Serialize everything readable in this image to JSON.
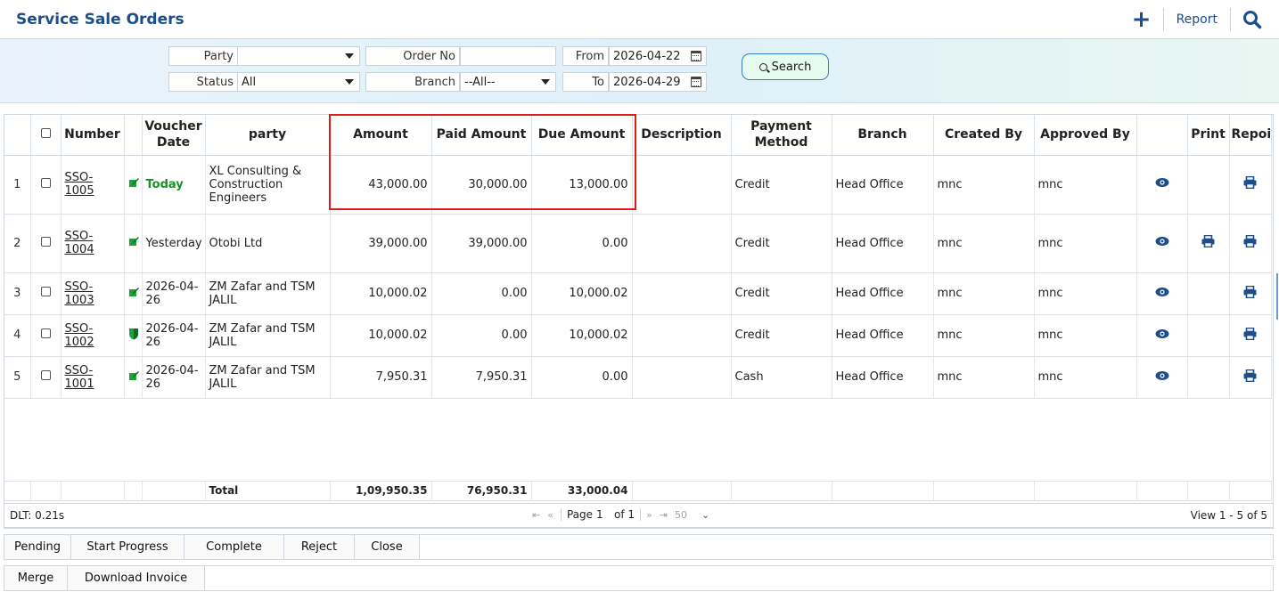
{
  "header": {
    "title": "Service Sale Orders",
    "report_label": "Report"
  },
  "filters": {
    "party_label": "Party",
    "party_value": "",
    "order_no_label": "Order No",
    "order_no_value": "",
    "from_label": "From",
    "from_value": "2026-04-22",
    "status_label": "Status",
    "status_value": "All",
    "branch_label": "Branch",
    "branch_value": "--All--",
    "to_label": "To",
    "to_value": "2026-04-29",
    "search_label": "Search"
  },
  "columns": {
    "number": "Number",
    "voucher_date": "Voucher Date",
    "party": "party",
    "amount": "Amount",
    "paid_amount": "Paid Amount",
    "due_amount": "Due Amount",
    "description": "Description",
    "payment_method": "Payment Method",
    "branch": "Branch",
    "created_by": "Created By",
    "approved_by": "Approved By",
    "print": "Print",
    "report": "Repoi"
  },
  "rows": [
    {
      "n": "1",
      "number": "SSO-1005",
      "date": "Today",
      "party": "XL Consulting & Construction Engineers",
      "amount": "43,000.00",
      "paid": "30,000.00",
      "due": "13,000.00",
      "description": "",
      "payment": "Credit",
      "branch": "Head Office",
      "created": "mnc",
      "approved": "mnc"
    },
    {
      "n": "2",
      "number": "SSO-1004",
      "date": "Yesterday",
      "party": "Otobi Ltd",
      "amount": "39,000.00",
      "paid": "39,000.00",
      "due": "0.00",
      "description": "",
      "payment": "Credit",
      "branch": "Head Office",
      "created": "mnc",
      "approved": "mnc"
    },
    {
      "n": "3",
      "number": "SSO-1003",
      "date": "2026-04-26",
      "party": "ZM Zafar and TSM JALIL",
      "amount": "10,000.02",
      "paid": "0.00",
      "due": "10,000.02",
      "description": "",
      "payment": "Credit",
      "branch": "Head Office",
      "created": "mnc",
      "approved": "mnc"
    },
    {
      "n": "4",
      "number": "SSO-1002",
      "date": "2026-04-26",
      "party": "ZM Zafar and TSM JALIL",
      "amount": "10,000.02",
      "paid": "0.00",
      "due": "10,000.02",
      "description": "",
      "payment": "Credit",
      "branch": "Head Office",
      "created": "mnc",
      "approved": "mnc"
    },
    {
      "n": "5",
      "number": "SSO-1001",
      "date": "2026-04-26",
      "party": "ZM Zafar and TSM JALIL",
      "amount": "7,950.31",
      "paid": "7,950.31",
      "due": "0.00",
      "description": "",
      "payment": "Cash",
      "branch": "Head Office",
      "created": "mnc",
      "approved": "mnc"
    }
  ],
  "totals": {
    "label": "Total",
    "amount": "1,09,950.35",
    "paid": "76,950.31",
    "due": "33,000.04"
  },
  "status_bar": {
    "dlt": "DLT: 0.21s",
    "page_label": "Page",
    "page_value": "1",
    "of_label": "of 1",
    "page_size": "50",
    "view": "View 1 - 5 of 5"
  },
  "actions_row1": [
    "Pending",
    "Start Progress",
    "Complete",
    "Reject",
    "Close"
  ],
  "actions_row2": [
    "Merge",
    "Download Invoice"
  ],
  "colors": {
    "title": "#1d4e89",
    "today": "#1a8f2b",
    "edit_icon": "#1fa03a",
    "action_icon": "#1d4e89",
    "highlight": "#e01919"
  },
  "icons": {
    "add": "plus-icon",
    "search": "search-icon",
    "calendar": "calendar-icon",
    "edit": "edit-icon",
    "view": "eye-icon",
    "print": "printer-icon"
  }
}
